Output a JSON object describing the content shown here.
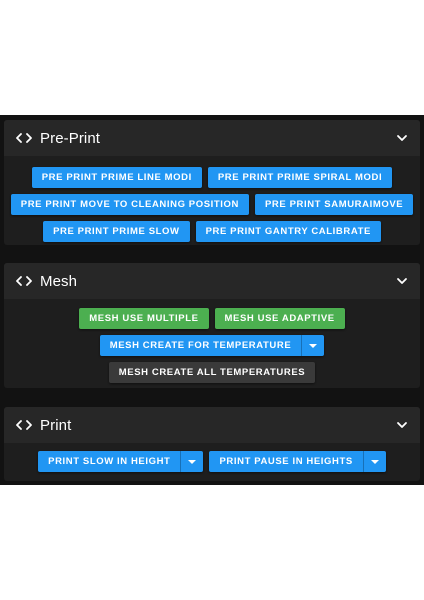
{
  "panels": [
    {
      "title": "Pre-Print",
      "rows": [
        [
          "PRE PRINT PRIME LINE MODI",
          "PRE PRINT PRIME SPIRAL MODI"
        ],
        [
          "PRE PRINT MOVE TO CLEANING POSITION",
          "PRE PRINT SAMURAIMOVE"
        ],
        [
          "PRE PRINT PRIME SLOW",
          "PRE PRINT GANTRY CALIBRATE"
        ]
      ]
    },
    {
      "title": "Mesh",
      "rows": [
        [
          "MESH USE MULTIPLE",
          "MESH USE ADAPTIVE"
        ],
        [
          "MESH CREATE FOR TEMPERATURE"
        ],
        [
          "MESH CREATE ALL TEMPERATURES"
        ]
      ]
    },
    {
      "title": "Print",
      "rows": [
        [
          "PRINT SLOW IN HEIGHT",
          "PRINT PAUSE IN HEIGHTS"
        ]
      ]
    }
  ],
  "icons": {
    "header_left": "code-icon",
    "header_right": "chevron-down-icon",
    "split_arrow": "caret-down-icon"
  },
  "colors": {
    "background": "#121212",
    "panel": "#1e1e1e",
    "panel_header": "#272727",
    "primary": "#2196f3",
    "success": "#4caf50",
    "neutral": "#3a3a3a"
  }
}
